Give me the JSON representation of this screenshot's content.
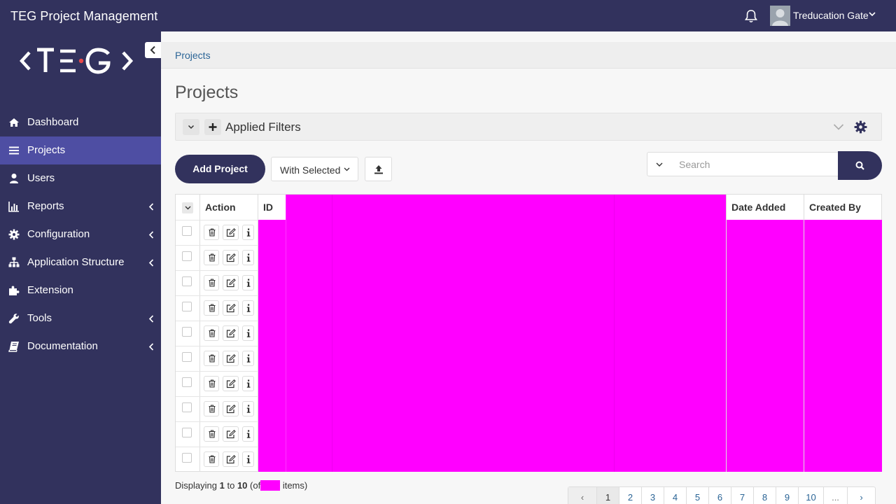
{
  "header": {
    "app_title": "TEG Project Management",
    "user_name": "Treducation Gate"
  },
  "sidebar": {
    "logo_text": "<TEG>",
    "items": [
      {
        "label": "Dashboard",
        "icon": "home-icon",
        "active": false,
        "chevron": false
      },
      {
        "label": "Projects",
        "icon": "list-icon",
        "active": true,
        "chevron": false
      },
      {
        "label": "Users",
        "icon": "user-icon",
        "active": false,
        "chevron": false
      },
      {
        "label": "Reports",
        "icon": "bar-chart-icon",
        "active": false,
        "chevron": true
      },
      {
        "label": "Configuration",
        "icon": "gear-icon",
        "active": false,
        "chevron": true
      },
      {
        "label": "Application Structure",
        "icon": "sitemap-icon",
        "active": false,
        "chevron": true
      },
      {
        "label": "Extension",
        "icon": "puzzle-icon",
        "active": false,
        "chevron": false
      },
      {
        "label": "Tools",
        "icon": "wrench-icon",
        "active": false,
        "chevron": true
      },
      {
        "label": "Documentation",
        "icon": "book-icon",
        "active": false,
        "chevron": true
      }
    ]
  },
  "breadcrumb": {
    "current": "Projects"
  },
  "page": {
    "title": "Projects"
  },
  "filters": {
    "label": "Applied Filters"
  },
  "toolbar": {
    "add_label": "Add Project",
    "with_selected_label": "With Selected",
    "search_placeholder": "Search"
  },
  "table": {
    "columns": [
      "Action",
      "ID",
      "Date Added",
      "Created By"
    ],
    "row_count": 10
  },
  "footer": {
    "displaying_prefix": "Displaying",
    "from": "1",
    "to_word": "to",
    "to": "10",
    "of_prefix": "(of",
    "items_suffix": "items)"
  },
  "pagination": {
    "prev": "‹",
    "pages": [
      "1",
      "2",
      "3",
      "4",
      "5",
      "6",
      "7",
      "8",
      "9",
      "10"
    ],
    "ellipsis": "...",
    "next": "›",
    "current": "1"
  },
  "colors": {
    "navy": "#32325d",
    "active_nav": "#4e4ea3",
    "link": "#2a6496",
    "placeholder_fill": "#ff00ff"
  }
}
